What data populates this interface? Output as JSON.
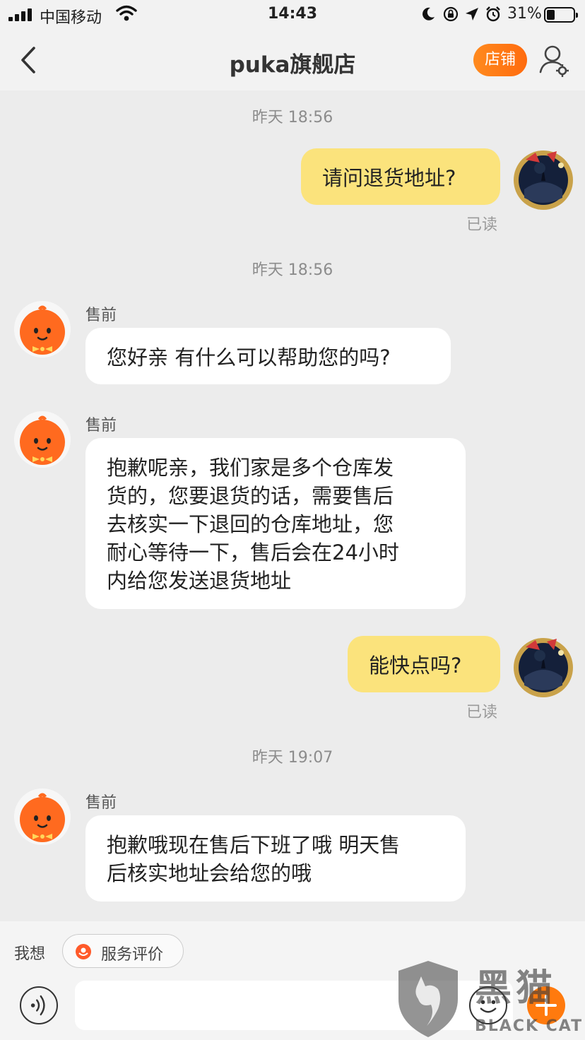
{
  "status_bar": {
    "carrier": "中国移动",
    "time": "14:43",
    "battery_percent": "31%",
    "battery_level": 0.31,
    "icons": [
      "signal-icon",
      "wifi-icon",
      "moon-icon",
      "rotation-lock-icon",
      "location-arrow-icon",
      "alarm-icon",
      "battery-icon"
    ]
  },
  "header": {
    "title": "puka旗舰店",
    "shop_button": "店铺",
    "back_icon": "chevron-left-icon",
    "user_icon": "user-settings-icon",
    "accent_color": "#ff7a0e"
  },
  "messages": [
    {
      "type": "timestamp",
      "text": "昨天 18:56"
    },
    {
      "type": "outgoing",
      "text": "请问退货地址?",
      "status": "已读"
    },
    {
      "type": "timestamp",
      "text": "昨天 18:56"
    },
    {
      "type": "incoming",
      "sender": "售前",
      "text": "您好亲 有什么可以帮助您的吗?"
    },
    {
      "type": "incoming",
      "sender": "售前",
      "lines": [
        "抱歉呢亲，我们家是多个仓库发",
        "货的，您要退货的话，需要售后",
        "去核实一下退回的仓库地址，您",
        "耐心等待一下，售后会在24小时",
        "内给您发送退货地址"
      ]
    },
    {
      "type": "outgoing",
      "text": "能快点吗?",
      "status": "已读"
    },
    {
      "type": "timestamp",
      "text": "昨天 19:07"
    },
    {
      "type": "incoming",
      "sender": "售前",
      "lines": [
        "抱歉哦现在售后下班了哦 明天售",
        "后核实地址会给您的哦"
      ]
    }
  ],
  "quick_bar": {
    "label": "我想",
    "chip": "服务评价"
  },
  "input_bar": {
    "placeholder": "",
    "icons": [
      "voice-icon",
      "emoji-icon",
      "plus-icon"
    ]
  },
  "watermark": {
    "text_cn": "黑猫",
    "text_en": "BLACK CAT"
  },
  "colors": {
    "outgoing_bubble": "#fbe37c",
    "incoming_bubble": "#ffffff",
    "background": "#ececec"
  }
}
